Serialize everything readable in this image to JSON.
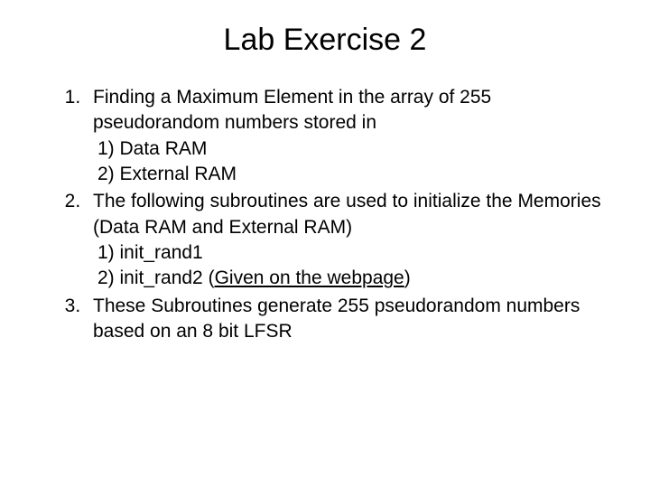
{
  "title": "Lab Exercise 2",
  "items": [
    {
      "text": "Finding a Maximum Element in the array of 255 pseudorandom numbers stored in",
      "sub": [
        "1)  Data RAM",
        "2)  External RAM"
      ]
    },
    {
      "text": "The following subroutines are used to initialize the Memories (Data RAM and External RAM)",
      "sub": [
        "1)  init_rand1"
      ],
      "sub_extra_prefix": "2)  init_rand2 (",
      "sub_extra_underline": "Given on the webpage",
      "sub_extra_suffix": ")"
    },
    {
      "text": "These Subroutines generate 255 pseudorandom numbers based on an 8 bit LFSR"
    }
  ]
}
